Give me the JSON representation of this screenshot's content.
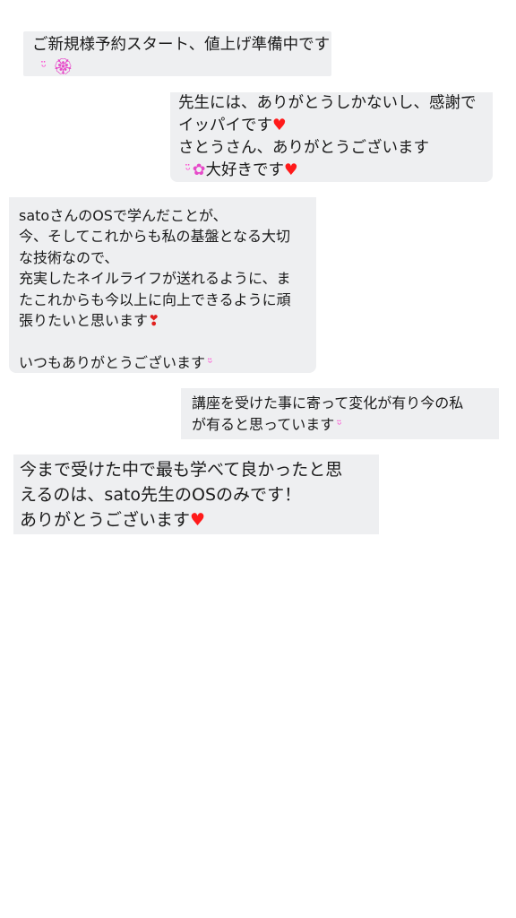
{
  "messages": [
    {
      "side": "left",
      "lines": [
        "ご新規様予約スタート、値上げ準備中です"
      ],
      "emoji_line": {
        "face": "ᵕ̈",
        "flower": "🏵"
      }
    },
    {
      "side": "right",
      "lines": [
        "先生には、ありがとうしかないし、感謝で",
        "イッパイです",
        "さとうさん、ありがとうございます",
        "大好きです"
      ],
      "emoji_face": "ᵕ̈",
      "emoji_flower": "✿",
      "heart": "♥"
    },
    {
      "side": "left",
      "lines": [
        "satoさんのOSで学んだことが、",
        "今、そしてこれからも私の基盤となる大切",
        "な技術なので、",
        "充実したネイルライフが送れるように、ま",
        "たこれからも今以上に向上できるように頑",
        "張りたいと思います",
        "",
        "いつもありがとうございます"
      ],
      "heart_exclamation": "❣",
      "emoji_face": "ᵕ̈"
    },
    {
      "side": "right",
      "lines": [
        "講座を受けた事に寄って変化が有り今の私",
        "が有ると思っています"
      ],
      "emoji_face": "ᵕ̈"
    },
    {
      "side": "left",
      "lines": [
        "今まで受けた中で最も学べて良かったと思",
        "えるのは、sato先生のOSのみです！",
        "ありがとうございます"
      ],
      "heart": "♥"
    }
  ],
  "colors": {
    "bubble": "#eeeff1",
    "heart": "#ff1a1a",
    "emoji": "#ff33cc"
  }
}
